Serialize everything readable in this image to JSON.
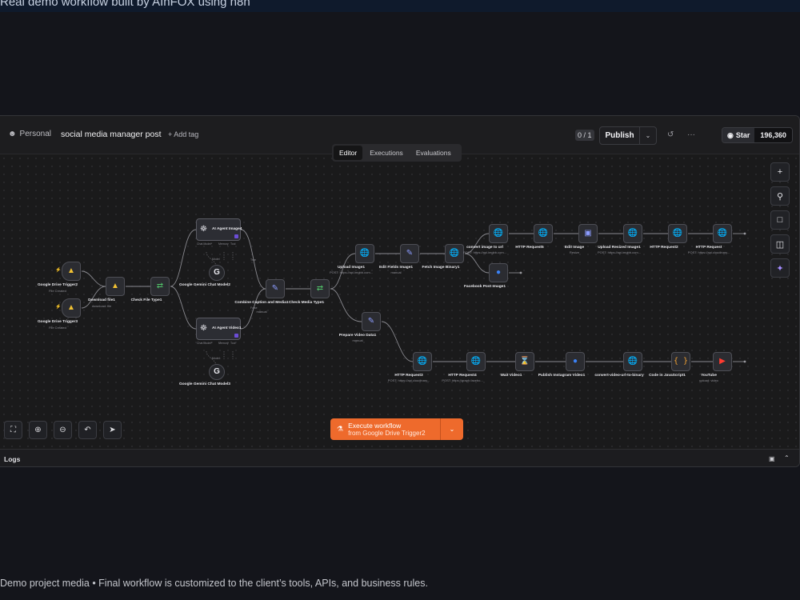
{
  "banner": {
    "text": "Real demo workflow built by AInFOX using n8n"
  },
  "header": {
    "project": "Personal",
    "workflow_title": "social media manager post",
    "add_tag": "+ Add tag",
    "counter": "0 / 1",
    "publish": "Publish",
    "github_star": "Star",
    "github_count": "196,360"
  },
  "tabs": [
    "Editor",
    "Executions",
    "Evaluations"
  ],
  "nodes": {
    "gdrive_trigger2": {
      "label": "Google Drive Trigger2",
      "sub": "File Created"
    },
    "gdrive_trigger3": {
      "label": "Google Drive Trigger3",
      "sub": "File Created"
    },
    "download_file1": {
      "label": "Download file1",
      "sub": "download: file"
    },
    "check_file_type1": {
      "label": "Check File Type1"
    },
    "ai_agent_image": {
      "label": "AI Agent Image4"
    },
    "ai_agent_video": {
      "label": "AI Agent Video1"
    },
    "gemini_model2": {
      "label": "Google Gemini Chat Model2"
    },
    "gemini_model3": {
      "label": "Google Gemini Chat Model3"
    },
    "combine_caption": {
      "label": "Combine Caption and Media1",
      "sub": "manual"
    },
    "check_media_type": {
      "label": "Check Media Type1"
    },
    "upload_image1": {
      "label": "Upload Image1",
      "sub": "POST: https://api.imgbb.com..."
    },
    "edit_fields_image1": {
      "label": "Edit Fields Image1",
      "sub": "manual"
    },
    "fetch_image_binary1": {
      "label": "Fetch Image Binary1"
    },
    "convert_image_url": {
      "label": "convert image to url",
      "sub": "POST: https://api.imgbb.com..."
    },
    "http_request5": {
      "label": "HTTP Request5"
    },
    "edit_image": {
      "label": "Edit Image",
      "sub": "Resize"
    },
    "upload_resized_image": {
      "label": "Upload Resized Image1",
      "sub": "POST: https://api.imgbb.com..."
    },
    "http_request2": {
      "label": "HTTP Request2"
    },
    "http_request": {
      "label": "HTTP Request",
      "sub": "POST: https://api.cloudinary..."
    },
    "facebook_post_image": {
      "label": "Facebook Post Image1"
    },
    "prepare_video_data": {
      "label": "Prepare Video Data1",
      "sub": "manual"
    },
    "http_request3": {
      "label": "HTTP Request3",
      "sub": "POST: https://api.cloudinary..."
    },
    "http_request4": {
      "label": "HTTP Request4",
      "sub": "POST: https://graph.facebo..."
    },
    "wait_video1": {
      "label": "Wait Video1"
    },
    "publish_instagram_video": {
      "label": "Publish Instagram Video1"
    },
    "convert_video_url": {
      "label": "convert-video-url-to-binary"
    },
    "code_js1": {
      "label": "Code in JavaScript1"
    },
    "youtube": {
      "label": "YouTube",
      "sub": "upload: video"
    }
  },
  "agent_ports": {
    "chat": "Chat Model*",
    "memory": "Memory",
    "tool": "Tool"
  },
  "agent_sub": "Model",
  "edge_labels": {
    "true": "True",
    "false": "False"
  },
  "execute": {
    "title": "Execute workflow",
    "subtitle": "from Google Drive Trigger2"
  },
  "logs": {
    "label": "Logs"
  },
  "caption": "Demo project media • Final workflow is customized to the client’s tools, APIs, and business rules.",
  "colors": {
    "accent": "#ee6a2c",
    "ai": "#a48cff",
    "canvas": "#1a1a1b"
  }
}
